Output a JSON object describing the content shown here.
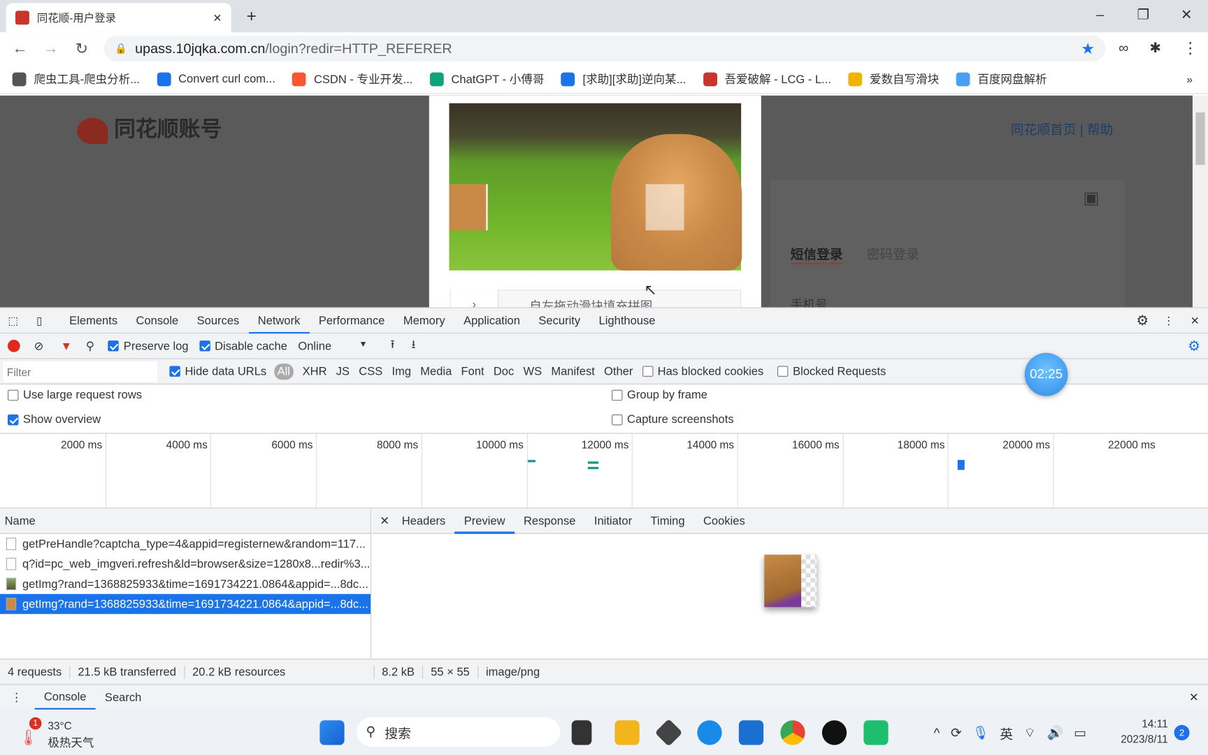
{
  "browser": {
    "tab_title": "同花顺-用户登录",
    "url_host": "upass.10jqka.com.cn",
    "url_path": "/login?redir=HTTP_REFERER",
    "bookmarks": [
      {
        "label": "爬虫工具-爬虫分析...",
        "color": "#555555"
      },
      {
        "label": "Convert curl com...",
        "color": "#1a73e8"
      },
      {
        "label": "CSDN - 专业开发...",
        "color": "#fc5531"
      },
      {
        "label": "ChatGPT - 小傅哥",
        "color": "#10a37f"
      },
      {
        "label": "[求助][求助]逆向某...",
        "color": "#1a73e8"
      },
      {
        "label": "吾爱破解 - LCG - L...",
        "color": "#c9342b"
      },
      {
        "label": "爱数自写滑块",
        "color": "#f0b400"
      },
      {
        "label": "百度网盘解析",
        "color": "#4a9ff5"
      }
    ],
    "more": "»"
  },
  "page": {
    "logo": "同花顺账号",
    "links": [
      "同花顺首页",
      "帮助"
    ],
    "login_tabs": [
      "短信登录",
      "密码登录"
    ],
    "phone_label": "手机号",
    "slider_hint": "自左拖动滑块填充拼图"
  },
  "devtools": {
    "tabs": [
      "Elements",
      "Console",
      "Sources",
      "Network",
      "Performance",
      "Memory",
      "Application",
      "Security",
      "Lighthouse"
    ],
    "active_tab": "Network",
    "toolbar": {
      "preserve_log": "Preserve log",
      "disable_cache": "Disable cache",
      "throttle": "Online"
    },
    "filter": {
      "placeholder": "Filter",
      "hide_data_urls": "Hide data URLs",
      "types": [
        "All",
        "XHR",
        "JS",
        "CSS",
        "Img",
        "Media",
        "Font",
        "Doc",
        "WS",
        "Manifest",
        "Other"
      ],
      "has_blocked_cookies": "Has blocked cookies",
      "blocked_requests": "Blocked Requests"
    },
    "options": {
      "large_rows": "Use large request rows",
      "show_overview": "Show overview",
      "group_by_frame": "Group by frame",
      "capture_screenshots": "Capture screenshots"
    },
    "overview_ticks": [
      "2000 ms",
      "4000 ms",
      "6000 ms",
      "8000 ms",
      "10000 ms",
      "12000 ms",
      "14000 ms",
      "16000 ms",
      "18000 ms",
      "20000 ms",
      "22000 ms"
    ],
    "requests_header": "Name",
    "requests": [
      "getPreHandle?captcha_type=4&appid=registernew&random=117...",
      "q?id=pc_web_imgveri.refresh&ld=browser&size=1280x8...redir%3...",
      "getImg?rand=1368825933&time=1691734221.0864&appid=...8dc...",
      "getImg?rand=1368825933&time=1691734221.0864&appid=...8dc..."
    ],
    "detail_tabs": [
      "Headers",
      "Preview",
      "Response",
      "Initiator",
      "Timing",
      "Cookies"
    ],
    "active_detail": "Preview",
    "status": [
      "4 requests",
      "21.5 kB transferred",
      "20.2 kB resources"
    ],
    "preview_info": [
      "8.2 kB",
      "55 × 55",
      "image/png"
    ],
    "drawer_tabs": [
      "Console",
      "Search"
    ]
  },
  "timer": "02:25",
  "taskbar": {
    "weather_temp": "33°C",
    "weather_desc": "极热天气",
    "weather_badge": "1",
    "search": "搜索",
    "ime": "英",
    "time": "14:11",
    "date": "2023/8/11",
    "notif": "2"
  }
}
